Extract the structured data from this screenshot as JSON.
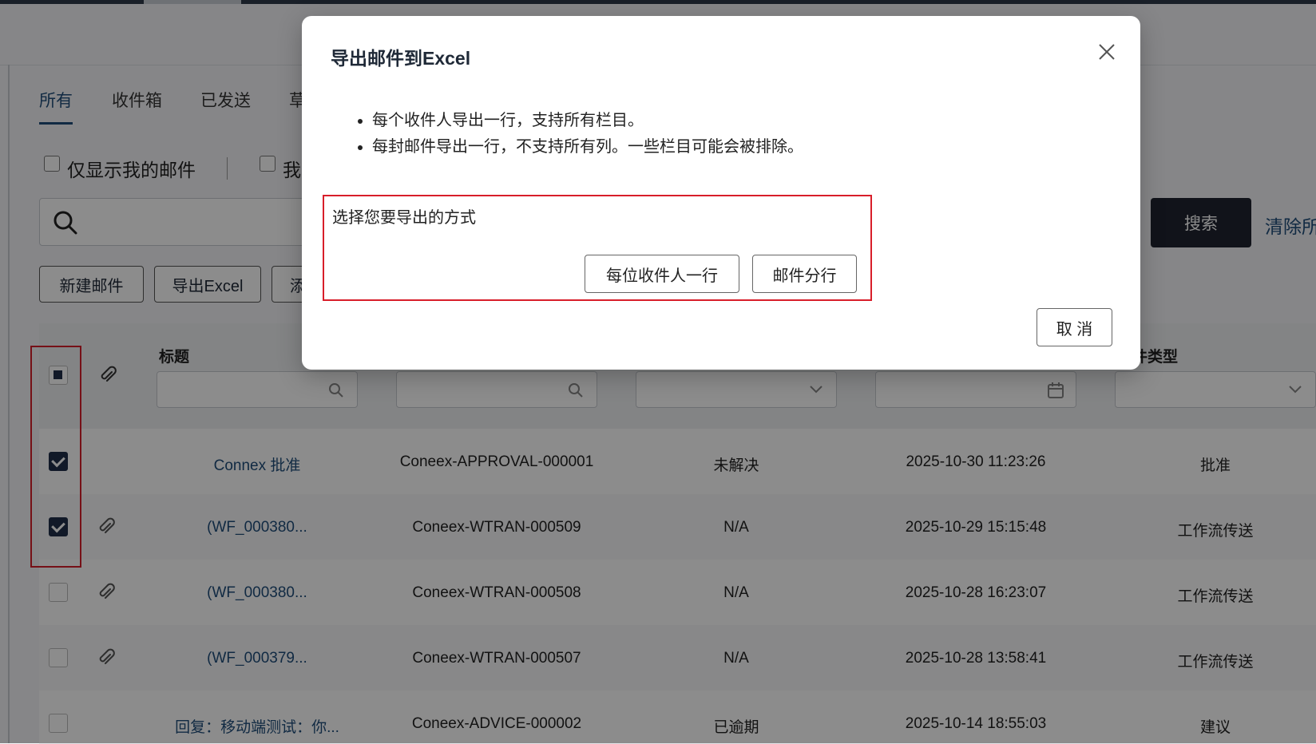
{
  "tabs": [
    "所有",
    "收件箱",
    "已发送",
    "草"
  ],
  "filters": {
    "only_mine": "仅显示我的邮件",
    "second_partial": "我"
  },
  "search": {
    "button": "搜索",
    "clear": "清除所"
  },
  "toolbar": {
    "new_mail": "新建邮件",
    "export_excel": "导出Excel",
    "add_partial": "添"
  },
  "table": {
    "col_title": "标题",
    "col_type_partial": "件类型",
    "rows": [
      {
        "title": "Connex 批准",
        "number": "Coneex-APPROVAL-000001",
        "status": "未解决",
        "date": "2025-10-30 11:23:26",
        "type": "批准",
        "checked": true,
        "attachment": false
      },
      {
        "title": "(WF_000380...",
        "number": "Coneex-WTRAN-000509",
        "status": "N/A",
        "date": "2025-10-29 15:15:48",
        "type": "工作流传送",
        "checked": true,
        "attachment": true
      },
      {
        "title": "(WF_000380...",
        "number": "Coneex-WTRAN-000508",
        "status": "N/A",
        "date": "2025-10-28 16:23:07",
        "type": "工作流传送",
        "checked": false,
        "attachment": true
      },
      {
        "title": "(WF_000379...",
        "number": "Coneex-WTRAN-000507",
        "status": "N/A",
        "date": "2025-10-28 13:58:41",
        "type": "工作流传送",
        "checked": false,
        "attachment": true
      },
      {
        "title": "回复：移动端测试：你...",
        "number": "Coneex-ADVICE-000002",
        "status": "已逾期",
        "date": "2025-10-14 18:55:03",
        "type": "建议",
        "checked": false,
        "attachment": false
      }
    ]
  },
  "modal": {
    "title": "导出邮件到Excel",
    "bullets": [
      "每个收件人导出一行，支持所有栏目。",
      "每封邮件导出一行，不支持所有列。一些栏目可能会被排除。"
    ],
    "choice_label": "选择您要导出的方式",
    "btn_per_recipient": "每位收件人一行",
    "btn_per_mail": "邮件分行",
    "cancel": "取 消"
  },
  "colors": {
    "accent": "#1f4d7a",
    "dark_button": "#1f2430",
    "highlight": "#d81e2a"
  }
}
